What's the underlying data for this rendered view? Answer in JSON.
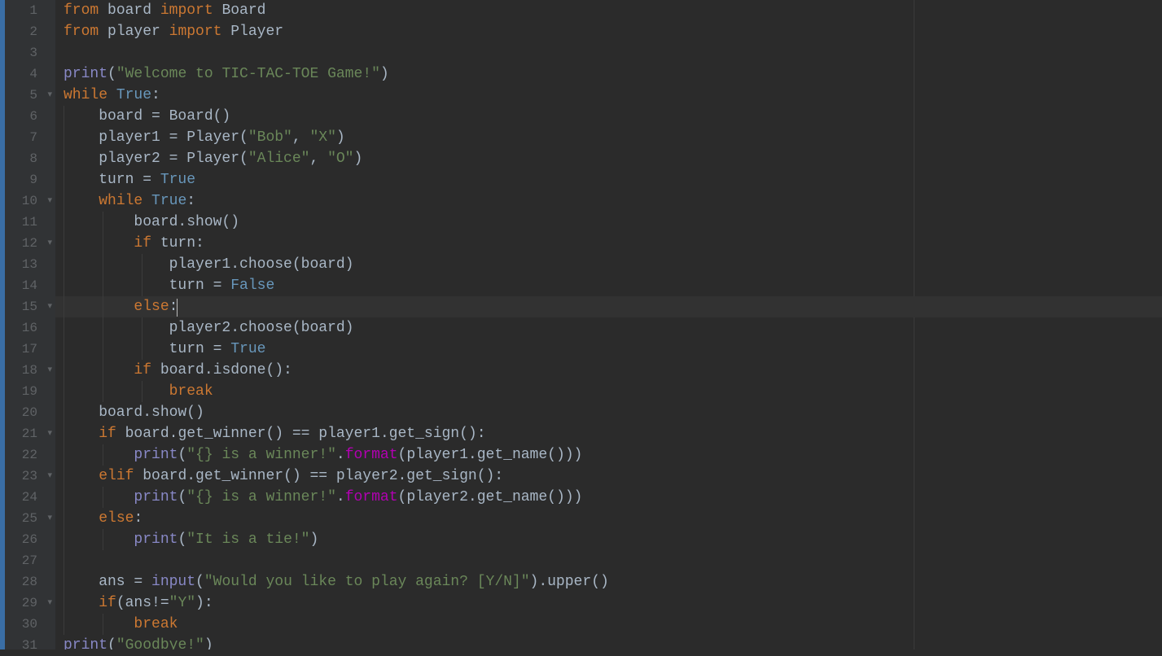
{
  "editor": {
    "current_line": 15,
    "vline_col": 1054,
    "lines": [
      {
        "num": 1,
        "fold": false,
        "tokens": [
          {
            "c": "kw",
            "t": "from"
          },
          {
            "c": "txt",
            "t": " board "
          },
          {
            "c": "kw",
            "t": "import"
          },
          {
            "c": "txt",
            "t": " Board"
          }
        ]
      },
      {
        "num": 2,
        "fold": false,
        "tokens": [
          {
            "c": "kw",
            "t": "from"
          },
          {
            "c": "txt",
            "t": " player "
          },
          {
            "c": "kw",
            "t": "import"
          },
          {
            "c": "txt",
            "t": " Player"
          }
        ]
      },
      {
        "num": 3,
        "fold": false,
        "tokens": []
      },
      {
        "num": 4,
        "fold": false,
        "tokens": [
          {
            "c": "builtin",
            "t": "print"
          },
          {
            "c": "txt",
            "t": "("
          },
          {
            "c": "str",
            "t": "\"Welcome to TIC-TAC-TOE Game!\""
          },
          {
            "c": "txt",
            "t": ")"
          }
        ]
      },
      {
        "num": 5,
        "fold": true,
        "tokens": [
          {
            "c": "kw",
            "t": "while"
          },
          {
            "c": "txt",
            "t": " "
          },
          {
            "c": "const",
            "t": "True"
          },
          {
            "c": "txt",
            "t": ":"
          }
        ]
      },
      {
        "num": 6,
        "fold": false,
        "indent": 1,
        "tokens": [
          {
            "c": "txt",
            "t": "    board = Board()"
          }
        ]
      },
      {
        "num": 7,
        "fold": false,
        "indent": 1,
        "tokens": [
          {
            "c": "txt",
            "t": "    player1 = Player("
          },
          {
            "c": "str",
            "t": "\"Bob\""
          },
          {
            "c": "txt",
            "t": ", "
          },
          {
            "c": "str",
            "t": "\"X\""
          },
          {
            "c": "txt",
            "t": ")"
          }
        ]
      },
      {
        "num": 8,
        "fold": false,
        "indent": 1,
        "tokens": [
          {
            "c": "txt",
            "t": "    player2 = Player("
          },
          {
            "c": "str",
            "t": "\"Alice\""
          },
          {
            "c": "txt",
            "t": ", "
          },
          {
            "c": "str",
            "t": "\"O\""
          },
          {
            "c": "txt",
            "t": ")"
          }
        ]
      },
      {
        "num": 9,
        "fold": false,
        "indent": 1,
        "tokens": [
          {
            "c": "txt",
            "t": "    turn = "
          },
          {
            "c": "const",
            "t": "True"
          }
        ]
      },
      {
        "num": 10,
        "fold": true,
        "indent": 1,
        "tokens": [
          {
            "c": "txt",
            "t": "    "
          },
          {
            "c": "kw",
            "t": "while"
          },
          {
            "c": "txt",
            "t": " "
          },
          {
            "c": "const",
            "t": "True"
          },
          {
            "c": "txt",
            "t": ":"
          }
        ]
      },
      {
        "num": 11,
        "fold": false,
        "indent": 2,
        "tokens": [
          {
            "c": "txt",
            "t": "        board.show()"
          }
        ]
      },
      {
        "num": 12,
        "fold": true,
        "indent": 2,
        "tokens": [
          {
            "c": "txt",
            "t": "        "
          },
          {
            "c": "kw",
            "t": "if"
          },
          {
            "c": "txt",
            "t": " turn:"
          }
        ]
      },
      {
        "num": 13,
        "fold": false,
        "indent": 3,
        "tokens": [
          {
            "c": "txt",
            "t": "            player1.choose(board)"
          }
        ]
      },
      {
        "num": 14,
        "fold": false,
        "indent": 3,
        "tokens": [
          {
            "c": "txt",
            "t": "            turn = "
          },
          {
            "c": "const",
            "t": "False"
          }
        ]
      },
      {
        "num": 15,
        "fold": true,
        "indent": 2,
        "cursor": true,
        "tokens": [
          {
            "c": "txt",
            "t": "        "
          },
          {
            "c": "kw",
            "t": "else"
          },
          {
            "c": "txt",
            "t": ":"
          }
        ]
      },
      {
        "num": 16,
        "fold": false,
        "indent": 3,
        "tokens": [
          {
            "c": "txt",
            "t": "            player2.choose(board)"
          }
        ]
      },
      {
        "num": 17,
        "fold": false,
        "indent": 3,
        "tokens": [
          {
            "c": "txt",
            "t": "            turn = "
          },
          {
            "c": "const",
            "t": "True"
          }
        ]
      },
      {
        "num": 18,
        "fold": true,
        "indent": 2,
        "tokens": [
          {
            "c": "txt",
            "t": "        "
          },
          {
            "c": "kw",
            "t": "if"
          },
          {
            "c": "txt",
            "t": " board.isdone():"
          }
        ]
      },
      {
        "num": 19,
        "fold": false,
        "indent": 3,
        "tokens": [
          {
            "c": "txt",
            "t": "            "
          },
          {
            "c": "kw",
            "t": "break"
          }
        ]
      },
      {
        "num": 20,
        "fold": false,
        "indent": 1,
        "tokens": [
          {
            "c": "txt",
            "t": "    board.show()"
          }
        ]
      },
      {
        "num": 21,
        "fold": true,
        "indent": 1,
        "tokens": [
          {
            "c": "txt",
            "t": "    "
          },
          {
            "c": "kw",
            "t": "if"
          },
          {
            "c": "txt",
            "t": " board.get_winner() == player1.get_sign():"
          }
        ]
      },
      {
        "num": 22,
        "fold": false,
        "indent": 2,
        "tokens": [
          {
            "c": "txt",
            "t": "        "
          },
          {
            "c": "builtin",
            "t": "print"
          },
          {
            "c": "txt",
            "t": "("
          },
          {
            "c": "str",
            "t": "\"{} is a winner!\""
          },
          {
            "c": "txt",
            "t": "."
          },
          {
            "c": "fmt",
            "t": "format"
          },
          {
            "c": "txt",
            "t": "(player1.get_name()))"
          }
        ]
      },
      {
        "num": 23,
        "fold": true,
        "indent": 1,
        "tokens": [
          {
            "c": "txt",
            "t": "    "
          },
          {
            "c": "kw",
            "t": "elif"
          },
          {
            "c": "txt",
            "t": " board.get_winner() == player2.get_sign():"
          }
        ]
      },
      {
        "num": 24,
        "fold": false,
        "indent": 2,
        "tokens": [
          {
            "c": "txt",
            "t": "        "
          },
          {
            "c": "builtin",
            "t": "print"
          },
          {
            "c": "txt",
            "t": "("
          },
          {
            "c": "str",
            "t": "\"{} is a winner!\""
          },
          {
            "c": "txt",
            "t": "."
          },
          {
            "c": "fmt",
            "t": "format"
          },
          {
            "c": "txt",
            "t": "(player2.get_name()))"
          }
        ]
      },
      {
        "num": 25,
        "fold": true,
        "indent": 1,
        "tokens": [
          {
            "c": "txt",
            "t": "    "
          },
          {
            "c": "kw",
            "t": "else"
          },
          {
            "c": "txt",
            "t": ":"
          }
        ]
      },
      {
        "num": 26,
        "fold": false,
        "indent": 2,
        "tokens": [
          {
            "c": "txt",
            "t": "        "
          },
          {
            "c": "builtin",
            "t": "print"
          },
          {
            "c": "txt",
            "t": "("
          },
          {
            "c": "str",
            "t": "\"It is a tie!\""
          },
          {
            "c": "txt",
            "t": ")"
          }
        ]
      },
      {
        "num": 27,
        "fold": false,
        "indent": 1,
        "tokens": []
      },
      {
        "num": 28,
        "fold": false,
        "indent": 1,
        "tokens": [
          {
            "c": "txt",
            "t": "    ans = "
          },
          {
            "c": "builtin",
            "t": "input"
          },
          {
            "c": "txt",
            "t": "("
          },
          {
            "c": "str",
            "t": "\"Would you like to play again? [Y/N]\""
          },
          {
            "c": "txt",
            "t": ").upper()"
          }
        ]
      },
      {
        "num": 29,
        "fold": true,
        "indent": 1,
        "tokens": [
          {
            "c": "txt",
            "t": "    "
          },
          {
            "c": "kw",
            "t": "if"
          },
          {
            "c": "txt",
            "t": "(ans!="
          },
          {
            "c": "str",
            "t": "\"Y\""
          },
          {
            "c": "txt",
            "t": "):"
          }
        ]
      },
      {
        "num": 30,
        "fold": false,
        "indent": 2,
        "tokens": [
          {
            "c": "txt",
            "t": "        "
          },
          {
            "c": "kw",
            "t": "break"
          }
        ]
      },
      {
        "num": 31,
        "fold": false,
        "tokens": [
          {
            "c": "builtin",
            "t": "print"
          },
          {
            "c": "txt",
            "t": "("
          },
          {
            "c": "str",
            "t": "\"Goodbye!\""
          },
          {
            "c": "txt",
            "t": ")"
          }
        ]
      }
    ]
  }
}
